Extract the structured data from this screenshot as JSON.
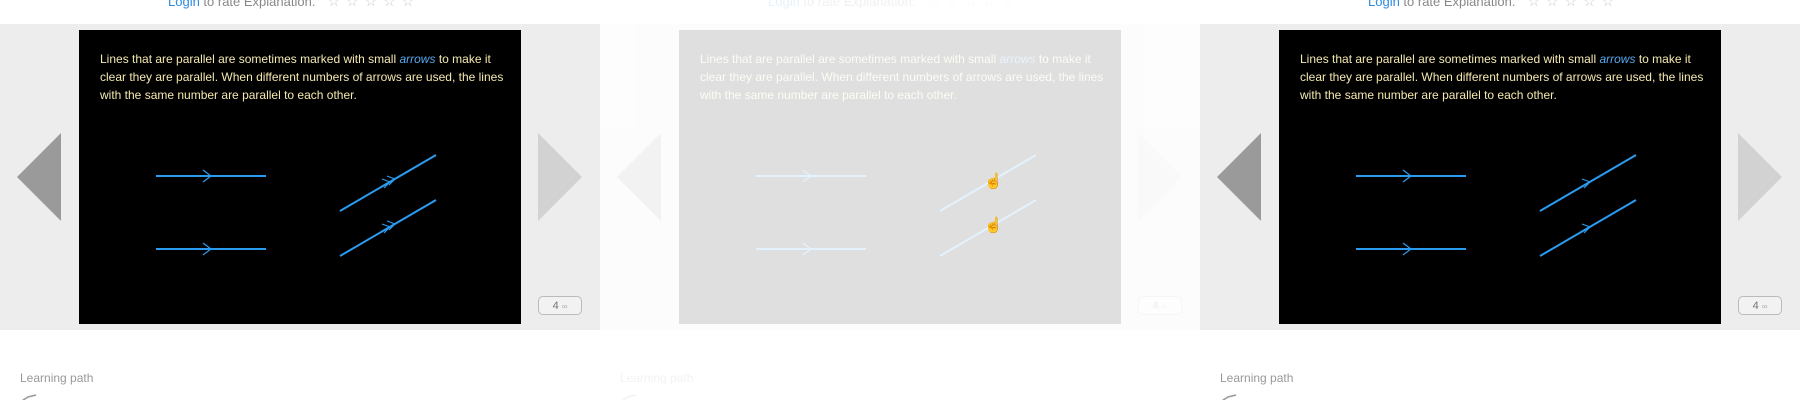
{
  "rating": {
    "login_link": "Login",
    "rest_text": " to rate Explanation.",
    "stars": "☆☆☆☆☆"
  },
  "slide": {
    "text_part1": "Lines that are parallel are sometimes marked with small ",
    "text_emphasis": "arrows",
    "text_part2": " to make it clear they are parallel. When different numbers of arrows are used, the lines with the same number are parallel to each other."
  },
  "counter": {
    "value": "4",
    "dots": "∞"
  },
  "learning_path": {
    "label": "Learning path"
  },
  "colors": {
    "line": "#2b9bf0",
    "text": "#f4e9b0",
    "link": "#2a8be0",
    "background": "#000000"
  },
  "icons": [
    "chevron-left-icon",
    "chevron-right-icon",
    "path-icon",
    "hand-cursor-icon"
  ]
}
